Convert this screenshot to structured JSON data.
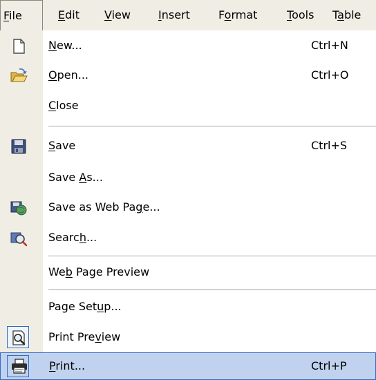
{
  "menubar": {
    "items": [
      {
        "pre": "",
        "key": "F",
        "post": "ile"
      },
      {
        "pre": "",
        "key": "E",
        "post": "dit"
      },
      {
        "pre": "",
        "key": "V",
        "post": "iew"
      },
      {
        "pre": "",
        "key": "I",
        "post": "nsert"
      },
      {
        "pre": "F",
        "key": "o",
        "post": "rmat"
      },
      {
        "pre": "",
        "key": "T",
        "post": "ools"
      },
      {
        "pre": "T",
        "key": "a",
        "post": "ble"
      }
    ]
  },
  "file_menu": {
    "items": [
      {
        "pre": "",
        "key": "N",
        "post": "ew...",
        "shortcut": "Ctrl+N",
        "icon": "new-document-icon"
      },
      {
        "pre": "",
        "key": "O",
        "post": "pen...",
        "shortcut": "Ctrl+O",
        "icon": "open-folder-icon"
      },
      {
        "pre": "",
        "key": "C",
        "post": "lose",
        "shortcut": "",
        "icon": ""
      },
      {
        "pre": "",
        "key": "S",
        "post": "ave",
        "shortcut": "Ctrl+S",
        "icon": "save-disk-icon"
      },
      {
        "pre": "Save ",
        "key": "A",
        "post": "s...",
        "shortcut": "",
        "icon": ""
      },
      {
        "pre": "Save as Web Pa",
        "key": "g",
        "post": "e...",
        "shortcut": "",
        "icon": "save-web-page-icon"
      },
      {
        "pre": "Searc",
        "key": "h",
        "post": "...",
        "shortcut": "",
        "icon": "search-icon"
      },
      {
        "pre": "We",
        "key": "b",
        "post": " Page Preview",
        "shortcut": "",
        "icon": ""
      },
      {
        "pre": "Page Set",
        "key": "u",
        "post": "p...",
        "shortcut": "",
        "icon": ""
      },
      {
        "pre": "Print Pre",
        "key": "v",
        "post": "iew",
        "shortcut": "",
        "icon": "print-preview-icon"
      },
      {
        "pre": "",
        "key": "P",
        "post": "rint...",
        "shortcut": "Ctrl+P",
        "icon": "printer-icon"
      }
    ]
  },
  "colors": {
    "menu_background": "#f0eee4",
    "highlight_background": "#c1d2ee",
    "highlight_border": "#316ac5"
  }
}
